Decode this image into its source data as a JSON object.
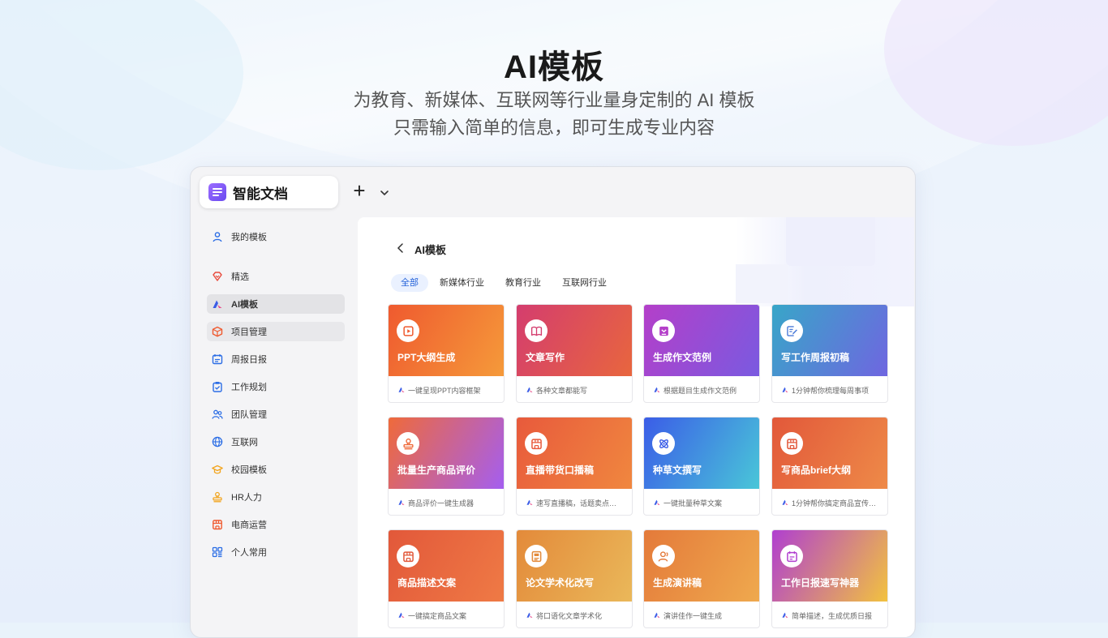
{
  "hero": {
    "title": "AI模板",
    "subtitle_line1": "为教育、新媒体、互联网等行业量身定制的 AI 模板",
    "subtitle_line2": "只需输入简单的信息，即可生成专业内容"
  },
  "window": {
    "tab_label": "智能文档",
    "new_tab_icon": "plus-icon",
    "dropdown_icon": "chevron-down-icon"
  },
  "sidebar": {
    "items": [
      {
        "label": "我的模板",
        "icon": "user-icon",
        "color": "#2b6de5"
      },
      {
        "label": "精选",
        "icon": "diamond-icon",
        "color": "#e84a3c"
      },
      {
        "label": "AI模板",
        "icon": "ai-logo-icon",
        "color": "#3b5de7",
        "active": true
      },
      {
        "label": "项目管理",
        "icon": "cube-icon",
        "color": "#ef5a2f"
      },
      {
        "label": "周报日报",
        "icon": "calendar-icon",
        "color": "#2b6de5"
      },
      {
        "label": "工作规划",
        "icon": "clipboard-icon",
        "color": "#2b6de5"
      },
      {
        "label": "团队管理",
        "icon": "team-icon",
        "color": "#2b6de5"
      },
      {
        "label": "互联网",
        "icon": "globe-icon",
        "color": "#2b6de5"
      },
      {
        "label": "校园模板",
        "icon": "graduation-cap-icon",
        "color": "#f2a51f"
      },
      {
        "label": "HR人力",
        "icon": "stamp-icon",
        "color": "#f2a51f"
      },
      {
        "label": "电商运营",
        "icon": "store-icon",
        "color": "#ef5a2f"
      },
      {
        "label": "个人常用",
        "icon": "grid-icon",
        "color": "#2b6de5"
      }
    ]
  },
  "main": {
    "title": "AI模板",
    "back_icon": "back-arrow-icon",
    "filters": [
      "全部",
      "新媒体行业",
      "教育行业",
      "互联网行业"
    ],
    "active_filter": "全部",
    "cards": [
      {
        "title": "PPT大纲生成",
        "desc": "一键呈现PPT内容框架",
        "icon": "play-icon",
        "colors": [
          "#ef5a2f",
          "#f59a3a"
        ],
        "icon_color": "#ef5a2f"
      },
      {
        "title": "文章写作",
        "desc": "各种文章都能写",
        "icon": "book-icon",
        "colors": [
          "#d43d6e",
          "#e8663e"
        ],
        "icon_color": "#d43d6e"
      },
      {
        "title": "生成作文范例",
        "desc": "根据题目生成作文范例",
        "icon": "inbox-icon",
        "colors": [
          "#b43fc9",
          "#7a5ae0"
        ],
        "icon_color": "#b43fc9"
      },
      {
        "title": "写工作周报初稿",
        "desc": "1分钟帮你梳理每周事项",
        "icon": "edit-doc-icon",
        "colors": [
          "#38a6c8",
          "#6f66e0"
        ],
        "icon_color": "#4b7bd8"
      },
      {
        "title": "批量生产商品评价",
        "desc": "商品评价一键生成器",
        "icon": "stamp-icon",
        "colors": [
          "#ef6a3a",
          "#a45ef0"
        ],
        "icon_color": "#ef6a3a"
      },
      {
        "title": "直播带货口播稿",
        "desc": "速写直播稿，话题卖点…",
        "icon": "store-icon",
        "colors": [
          "#e85a3c",
          "#f0873f"
        ],
        "icon_color": "#e85a3c"
      },
      {
        "title": "种草文撰写",
        "desc": "一键批量种草文案",
        "icon": "atom-icon",
        "colors": [
          "#3b5de7",
          "#49c6d8"
        ],
        "icon_color": "#3b5de7"
      },
      {
        "title": "写商品brief大纲",
        "desc": "1分钟帮你搞定商品宣传…",
        "icon": "store-icon",
        "colors": [
          "#e2583a",
          "#ee8a48"
        ],
        "icon_color": "#e2583a"
      },
      {
        "title": "商品描述文案",
        "desc": "一键搞定商品文案",
        "icon": "store-icon",
        "colors": [
          "#e2583a",
          "#ef7a45"
        ],
        "icon_color": "#e2583a"
      },
      {
        "title": "论文学术化改写",
        "desc": "将口语化文章学术化",
        "icon": "paper-icon",
        "colors": [
          "#e38a3a",
          "#eab85a"
        ],
        "icon_color": "#e38a3a"
      },
      {
        "title": "生成演讲稿",
        "desc": "演讲佳作一键生成",
        "icon": "speaker-icon",
        "colors": [
          "#e47a3a",
          "#efa94e"
        ],
        "icon_color": "#e47a3a"
      },
      {
        "title": "工作日报速写神器",
        "desc": "简单描述，生成优质日报",
        "icon": "daily-report-icon",
        "colors": [
          "#b03fd0",
          "#f2c23f"
        ],
        "icon_color": "#b03fd0"
      }
    ]
  }
}
